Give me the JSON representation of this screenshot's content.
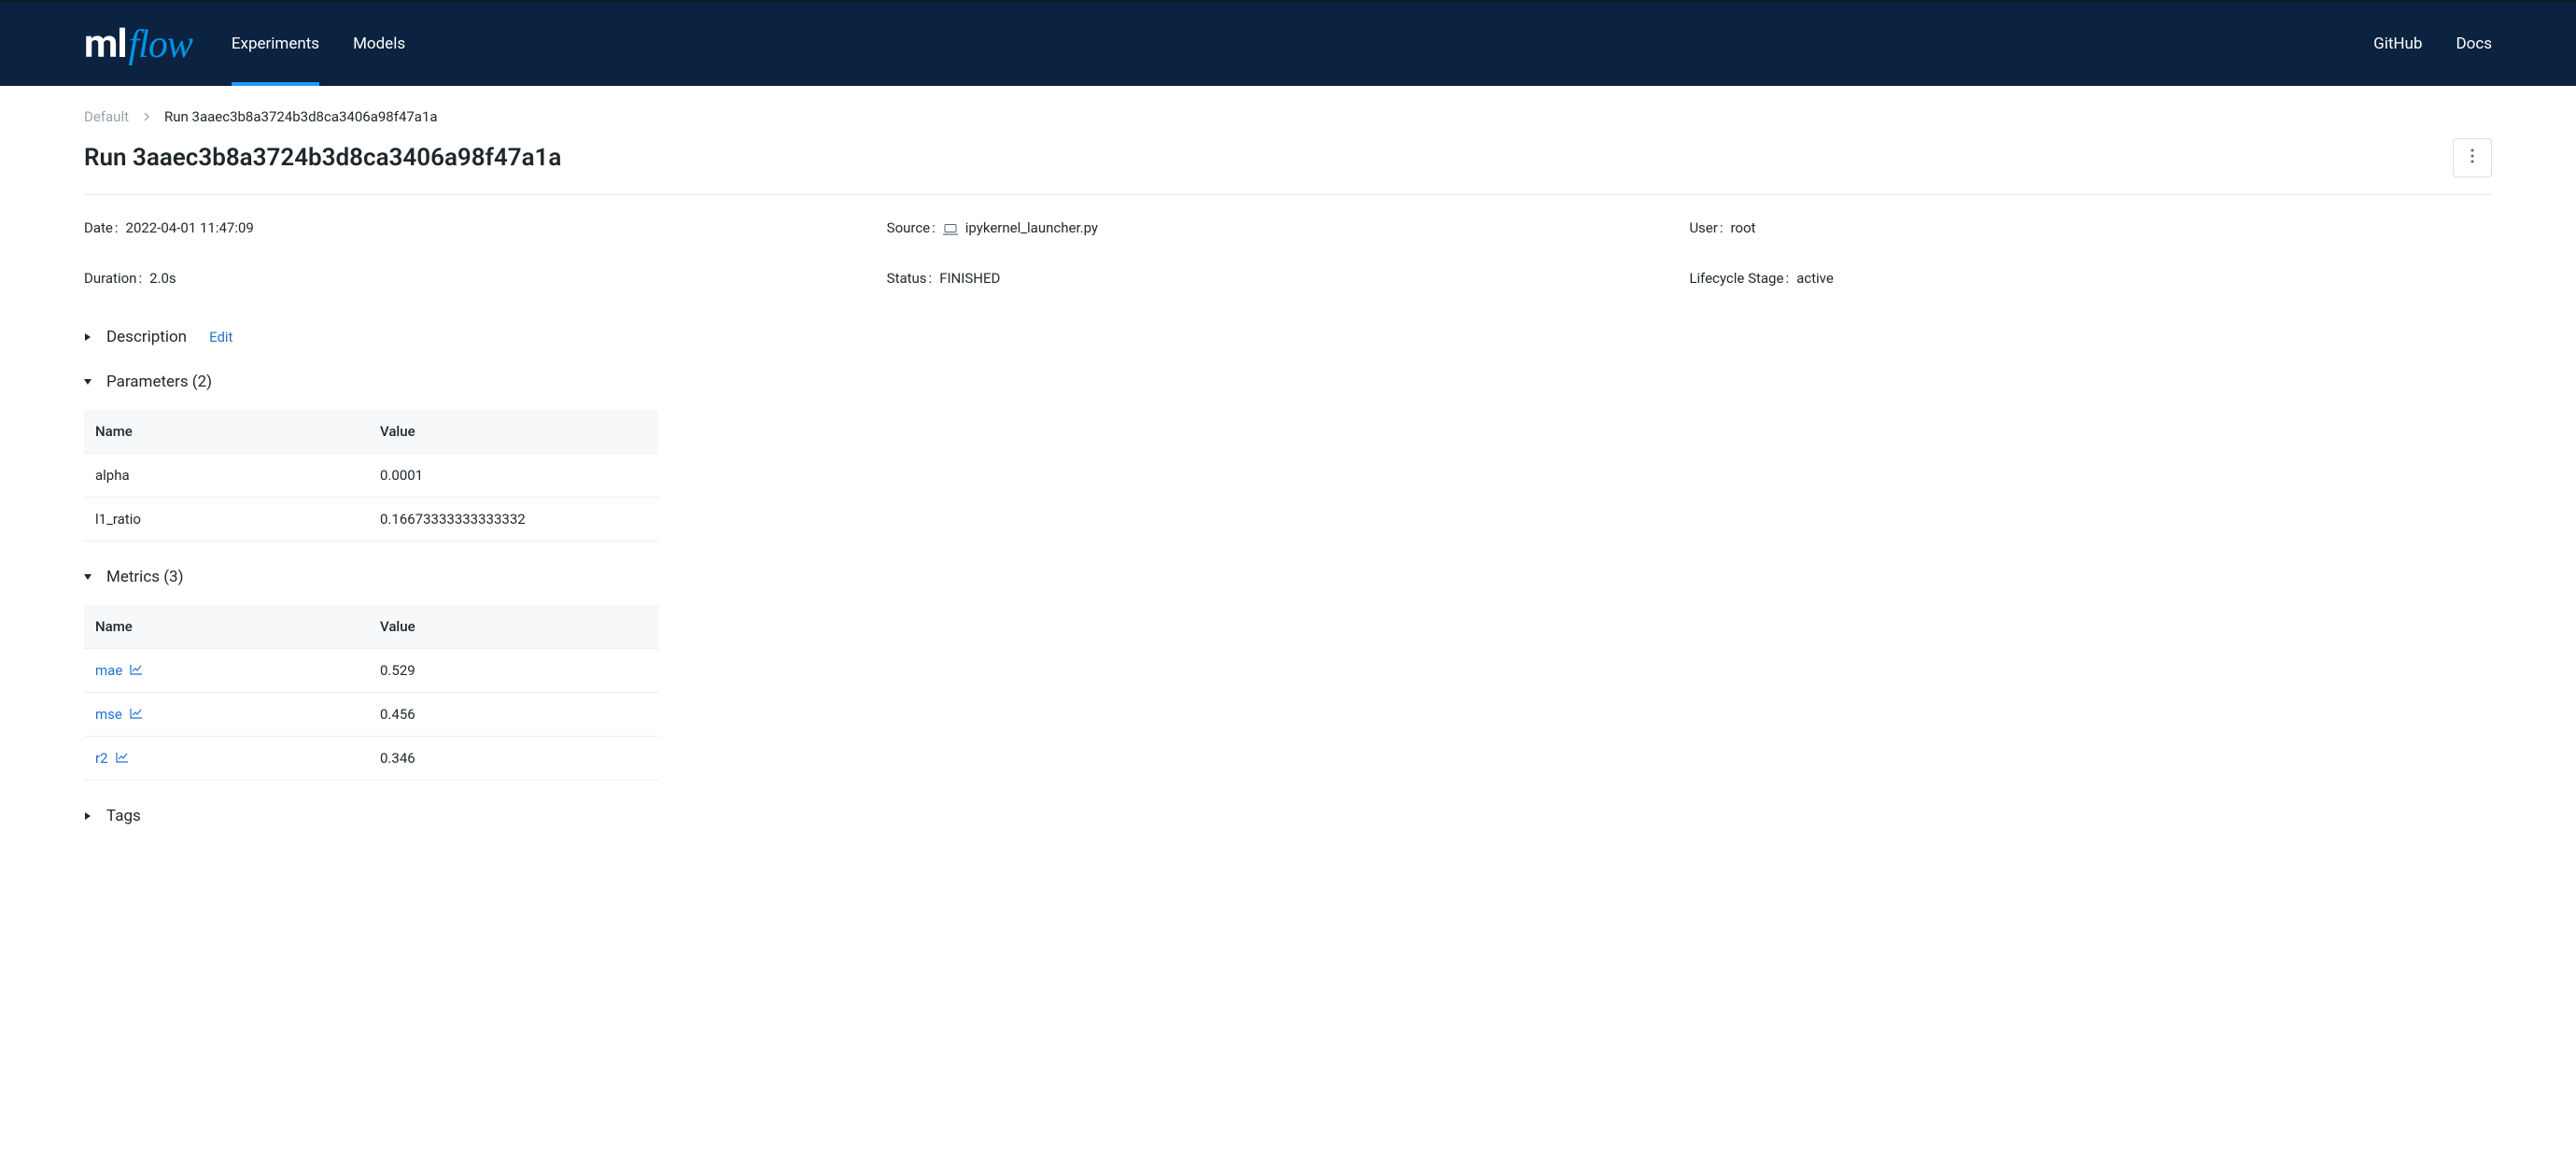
{
  "nav": {
    "tabs": {
      "experiments": "Experiments",
      "models": "Models"
    },
    "links": {
      "github": "GitHub",
      "docs": "Docs"
    }
  },
  "breadcrumb": {
    "root": "Default",
    "current": "Run 3aaec3b8a3724b3d8ca3406a98f47a1a"
  },
  "title": "Run 3aaec3b8a3724b3d8ca3406a98f47a1a",
  "meta": {
    "date": {
      "label": "Date",
      "value": "2022-04-01 11:47:09"
    },
    "source": {
      "label": "Source",
      "value": "ipykernel_launcher.py"
    },
    "user": {
      "label": "User",
      "value": "root"
    },
    "duration": {
      "label": "Duration",
      "value": "2.0s"
    },
    "status": {
      "label": "Status",
      "value": "FINISHED"
    },
    "lifecycle": {
      "label": "Lifecycle Stage",
      "value": "active"
    }
  },
  "sections": {
    "description": {
      "title": "Description",
      "edit": "Edit"
    },
    "parameters": {
      "title": "Parameters (2)",
      "headers": {
        "name": "Name",
        "value": "Value"
      },
      "rows": [
        {
          "name": "alpha",
          "value": "0.0001"
        },
        {
          "name": "l1_ratio",
          "value": "0.16673333333333332"
        }
      ]
    },
    "metrics": {
      "title": "Metrics (3)",
      "headers": {
        "name": "Name",
        "value": "Value"
      },
      "rows": [
        {
          "name": "mae",
          "value": "0.529"
        },
        {
          "name": "mse",
          "value": "0.456"
        },
        {
          "name": "r2",
          "value": "0.346"
        }
      ]
    },
    "tags": {
      "title": "Tags"
    }
  }
}
